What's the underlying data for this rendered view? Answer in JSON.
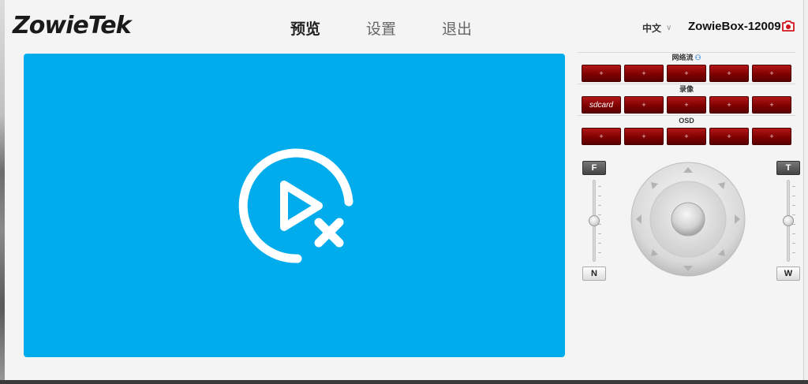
{
  "brand": {
    "logo_text": "ZowieTek"
  },
  "nav": {
    "items": [
      {
        "label": "预览",
        "active": true
      },
      {
        "label": "设置",
        "active": false
      },
      {
        "label": "退出",
        "active": false
      }
    ]
  },
  "header": {
    "language": "中文",
    "device_name": "ZowieBox-12009",
    "snapshot_icon": "camera-icon"
  },
  "video": {
    "status_icon": "video-unavailable-icon",
    "background_color": "#00acec"
  },
  "panel": {
    "stream": {
      "label": "网络流",
      "icon": "user-icon",
      "buttons": [
        "+",
        "+",
        "+",
        "+",
        "+"
      ]
    },
    "record": {
      "label": "录像",
      "buttons": [
        "sdcard",
        "+",
        "+",
        "+",
        "+"
      ]
    },
    "osd": {
      "label": "OSD",
      "buttons": [
        "+",
        "+",
        "+",
        "+",
        "+"
      ]
    },
    "button_color": "#8b0000"
  },
  "ptz": {
    "focus_far": "F",
    "focus_near": "N",
    "zoom_tele": "T",
    "zoom_wide": "W",
    "focus_level": 0.5,
    "zoom_level": 0.5
  }
}
